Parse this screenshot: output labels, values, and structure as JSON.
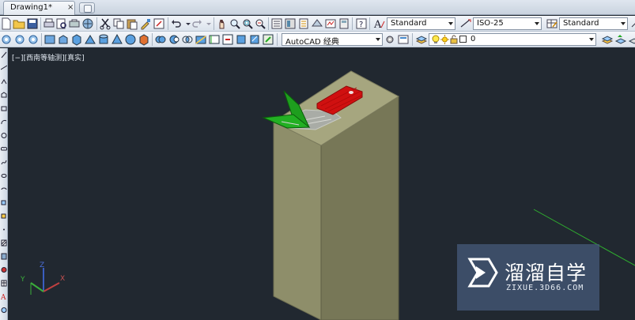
{
  "tabs": {
    "drawing_label": "Drawing1*",
    "close_glyph": "×"
  },
  "toolbar1": {
    "text_style": "Standard",
    "dim_style": "ISO-25",
    "table_style": "Standard"
  },
  "toolbar2": {
    "workspace": "AutoCAD 经典",
    "layer": "0"
  },
  "viewport": {
    "label": "[−][西南等轴测][真实]",
    "ucs_axes": {
      "x": "X",
      "y": "Y",
      "z": "Z"
    },
    "colors": {
      "background": "#212830",
      "box_front": "#8e8e6a",
      "box_side": "#777757",
      "box_top": "#a6a67f",
      "red_part": "#d01010",
      "green_part": "#1e9e1e",
      "line": "#2fae2f"
    }
  },
  "watermark": {
    "title": "溜溜自学",
    "url": "ZIXUE.3D66.COM",
    "icon": "play-icon"
  }
}
